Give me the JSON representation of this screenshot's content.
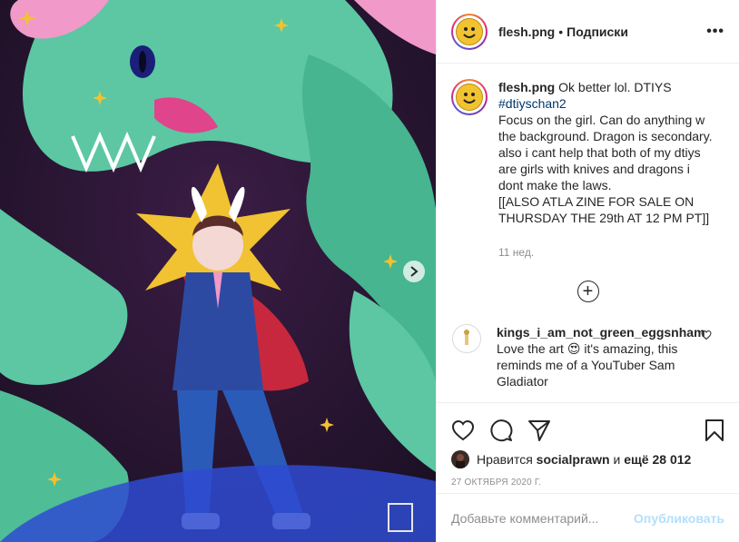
{
  "header": {
    "username": "flesh.png",
    "separator": "•",
    "follow_label": "Подписки",
    "more_label": "•••"
  },
  "caption": {
    "username": "flesh.png",
    "text_first": "Ok better lol. DTIYS",
    "hashtag": "#dtiyschan2",
    "lines": [
      "Focus on the girl. Can do anything w the background. Dragon is secondary. also i cant help that both of my dtiys are girls with knives and dragons i dont make the laws.",
      "[[ALSO ATLA ZINE FOR SALE ON THURSDAY THE 29th AT 12 PM PT]]"
    ],
    "time": "11 нед."
  },
  "load_more_label": "+",
  "comment": {
    "username": "kings_i_am_not_green_eggsnham",
    "text_before_emoji": "Love the art",
    "emoji": "😍",
    "text_after_emoji": "it's amazing, this reminds me of a YouTuber Sam Gladiator"
  },
  "likes": {
    "prefix": "Нравится",
    "user": "socialprawn",
    "and": "и",
    "others": "ещё 28 012"
  },
  "date": "27 октября 2020 г.",
  "add_comment": {
    "placeholder": "Добавьте комментарий...",
    "publish_label": "Опубликовать"
  },
  "colors": {
    "link": "#00376b",
    "publish_disabled": "#b2dffc",
    "muted": "#8e8e8e"
  },
  "icons": [
    "heart-icon",
    "comment-icon",
    "share-icon",
    "bookmark-icon",
    "more-icon",
    "chevron-right-icon",
    "plus-circle-icon"
  ]
}
